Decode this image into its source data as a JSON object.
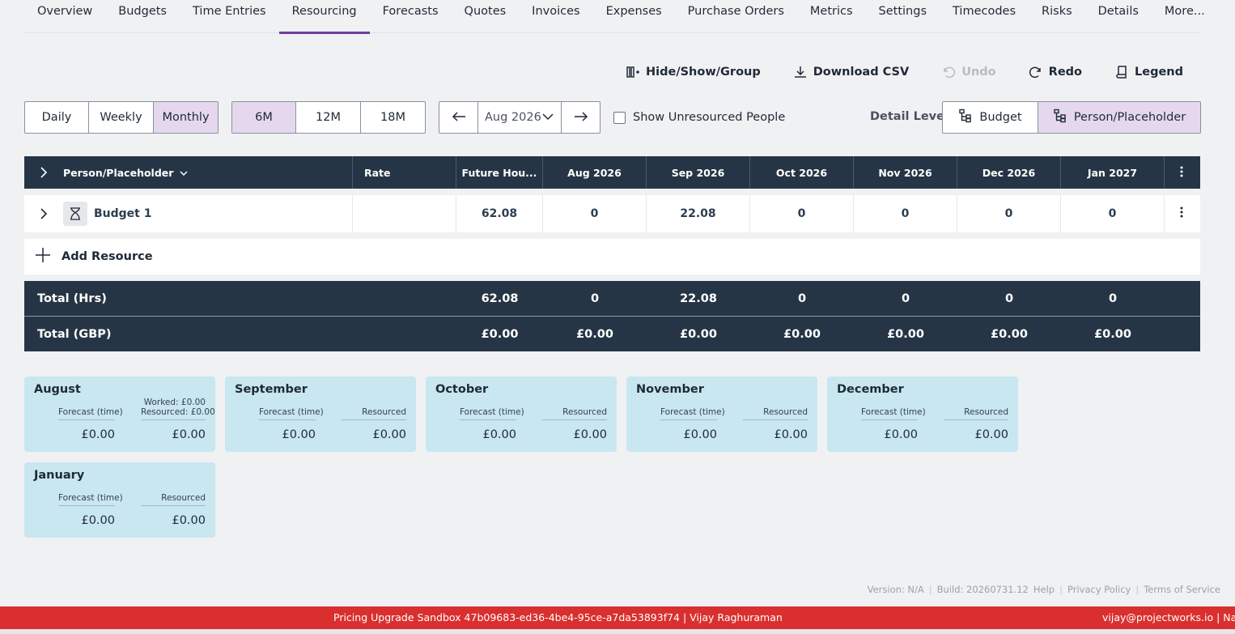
{
  "tabs": [
    "Overview",
    "Budgets",
    "Time Entries",
    "Resourcing",
    "Forecasts",
    "Quotes",
    "Invoices",
    "Expenses",
    "Purchase Orders",
    "Metrics",
    "Settings",
    "Timecodes",
    "Risks",
    "Details",
    "More..."
  ],
  "active_tab": "Resourcing",
  "toolbar": {
    "hide_show_group": "Hide/Show/Group",
    "download_csv": "Download CSV",
    "undo": "Undo",
    "redo": "Redo",
    "legend": "Legend"
  },
  "granularity": {
    "options": [
      "Daily",
      "Weekly",
      "Monthly"
    ],
    "selected": "Monthly"
  },
  "range": {
    "options": [
      "6M",
      "12M",
      "18M"
    ],
    "selected": "6M"
  },
  "date_picker": {
    "value": "Aug 2026"
  },
  "show_unresourced": {
    "label": "Show Unresourced People",
    "checked": false
  },
  "detail_level": {
    "label": "Detail Level",
    "options": [
      "Budget",
      "Person/Placeholder"
    ],
    "selected": "Person/Placeholder"
  },
  "grid": {
    "headers": {
      "person": "Person/Placeholder",
      "rate": "Rate",
      "future": "Future Hou...",
      "months": [
        "Aug 2026",
        "Sep 2026",
        "Oct 2026",
        "Nov 2026",
        "Dec 2026",
        "Jan 2027"
      ]
    },
    "rows": [
      {
        "name": "Budget 1",
        "rate": "",
        "future": "62.08",
        "months": [
          "0",
          "22.08",
          "0",
          "0",
          "0",
          "0"
        ]
      }
    ],
    "add_resource": "Add Resource",
    "totals": [
      {
        "label": "Total (Hrs)",
        "future": "62.08",
        "months": [
          "0",
          "22.08",
          "0",
          "0",
          "0",
          "0"
        ]
      },
      {
        "label": "Total (GBP)",
        "future": "£0.00",
        "months": [
          "£0.00",
          "£0.00",
          "£0.00",
          "£0.00",
          "£0.00",
          "£0.00"
        ]
      }
    ]
  },
  "cards": [
    {
      "month": "August",
      "forecast_label": "Forecast (time)",
      "forecast": "£0.00",
      "worked": "Worked: £0.00",
      "resourced_label": "Resourced: £0.00",
      "resourced": "£0.00"
    },
    {
      "month": "September",
      "forecast_label": "Forecast (time)",
      "forecast": "£0.00",
      "resourced_label": "Resourced",
      "resourced": "£0.00"
    },
    {
      "month": "October",
      "forecast_label": "Forecast (time)",
      "forecast": "£0.00",
      "resourced_label": "Resourced",
      "resourced": "£0.00"
    },
    {
      "month": "November",
      "forecast_label": "Forecast (time)",
      "forecast": "£0.00",
      "resourced_label": "Resourced",
      "resourced": "£0.00"
    },
    {
      "month": "December",
      "forecast_label": "Forecast (time)",
      "forecast": "£0.00",
      "resourced_label": "Resourced",
      "resourced": "£0.00"
    },
    {
      "month": "January",
      "forecast_label": "Forecast (time)",
      "forecast": "£0.00",
      "resourced_label": "Resourced",
      "resourced": "£0.00"
    }
  ],
  "footer": {
    "version": "Version: N/A",
    "build": "Build: 20260731.12",
    "help": "Help",
    "privacy": "Privacy Policy",
    "terms": "Terms of Service"
  },
  "banner": {
    "center": "Pricing Upgrade Sandbox 47b09683-ed36-4be4-95ce-a7da53893f74 | Vijay Raghuraman",
    "right": "vijay@projectworks.io | Nativ"
  },
  "colors": {
    "accent": "#6b3fa0",
    "header_bg": "#263545",
    "card_bg": "#c8e7f0",
    "banner_bg": "#d9302f",
    "selected_bg": "#e5d8ee"
  }
}
